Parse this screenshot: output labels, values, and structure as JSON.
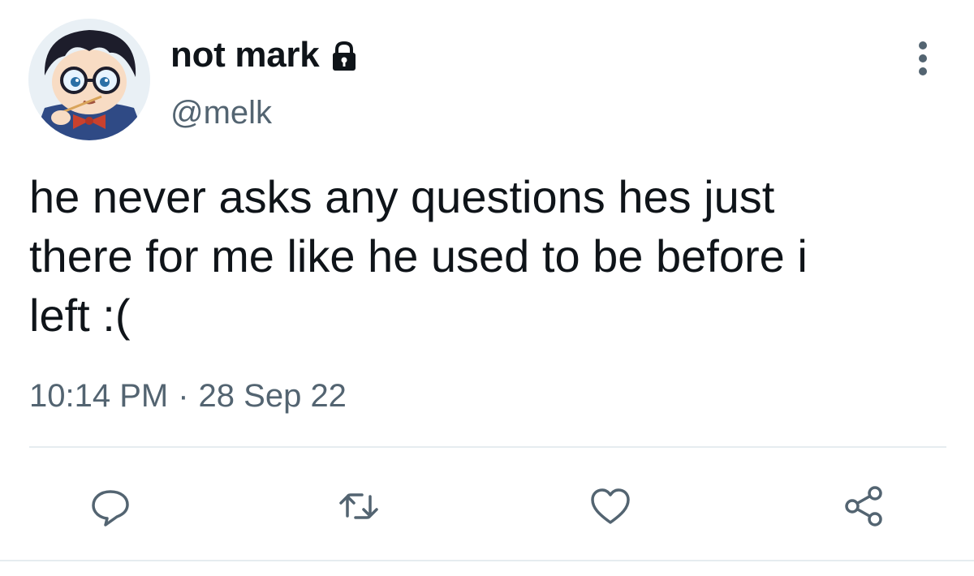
{
  "tweet": {
    "display_name": "not mark",
    "handle": "@melk",
    "text": "he never asks any questions hes just\nthere for me like he used to be before i\nleft :(",
    "time": "10:14 PM",
    "separator": "·",
    "date": "28 Sep 22",
    "protected_icon": "lock-icon",
    "more_icon": "more-vertical-icon"
  },
  "actions": [
    {
      "name": "reply",
      "icon": "reply-icon"
    },
    {
      "name": "retweet",
      "icon": "retweet-icon"
    },
    {
      "name": "like",
      "icon": "heart-icon"
    },
    {
      "name": "share",
      "icon": "share-icon"
    }
  ],
  "colors": {
    "text": "#0f1419",
    "secondary": "#536471",
    "divider": "#e6ecf0"
  }
}
